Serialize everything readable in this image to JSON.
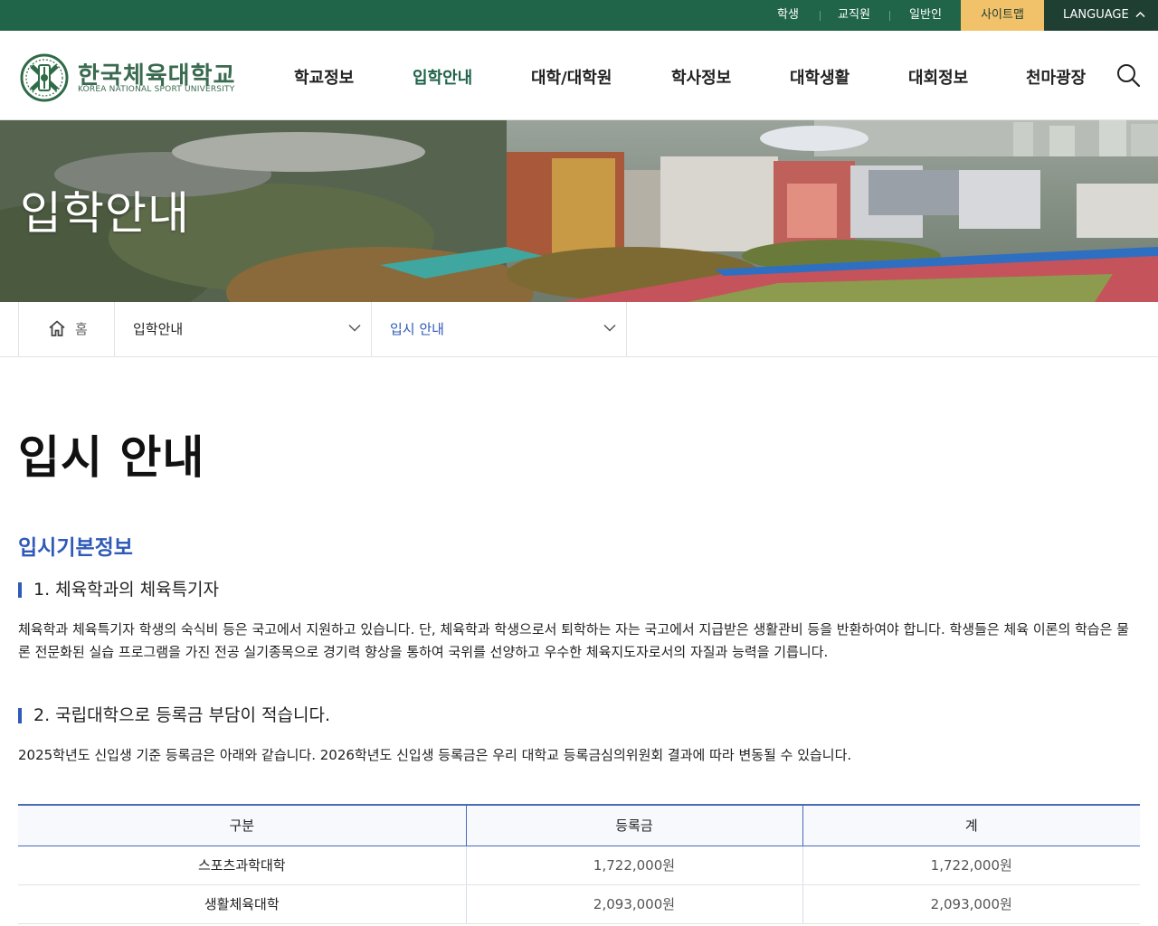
{
  "topbar": {
    "links": [
      "학생",
      "교직원",
      "일반인"
    ],
    "sitemap": "사이트맵",
    "language": "LANGUAGE"
  },
  "logo": {
    "title": "한국체육대학교",
    "subtitle": "KOREA NATIONAL SPORT UNIVERSITY"
  },
  "gnb": {
    "items": [
      "학교정보",
      "입학안내",
      "대학/대학원",
      "학사정보",
      "대학생활",
      "대회정보",
      "천마광장"
    ],
    "active_index": 1
  },
  "hero": {
    "title": "입학안내"
  },
  "breadcrumb": {
    "home": "홈",
    "level1": "입학안내",
    "level2": "입시 안내"
  },
  "content": {
    "page_title": "입시 안내",
    "section_title": "입시기본정보",
    "sub1": {
      "heading": "1. 체육학과의 체육특기자",
      "body": "체육학과 체육특기자 학생의 숙식비 등은 국고에서 지원하고 있습니다. 단, 체육학과 학생으로서 퇴학하는 자는 국고에서 지급받은 생활관비 등을 반환하여야 합니다. 학생들은 체육 이론의 학습은 물론 전문화된 실습 프로그램을 가진 전공 실기종목으로 경기력 향상을 통하여 국위를 선양하고 우수한 체육지도자로서의 자질과 능력을 기릅니다."
    },
    "sub2": {
      "heading": "2. 국립대학으로 등록금 부담이 적습니다.",
      "body": "2025학년도 신입생 기준 등록금은 아래와 같습니다. 2026학년도 신입생 등록금은 우리 대학교 등록금심의위원회 결과에 따라 변동될 수 있습니다."
    },
    "table": {
      "headers": [
        "구분",
        "등록금",
        "계"
      ],
      "rows": [
        [
          "스포츠과학대학",
          "1,722,000원",
          "1,722,000원"
        ],
        [
          "생활체육대학",
          "2,093,000원",
          "2,093,000원"
        ]
      ]
    }
  },
  "colors": {
    "brand_green": "#20644a",
    "sitemap_yellow": "#f2c26b",
    "language_dark": "#1f3f33",
    "accent_blue": "#2f5ab8"
  }
}
